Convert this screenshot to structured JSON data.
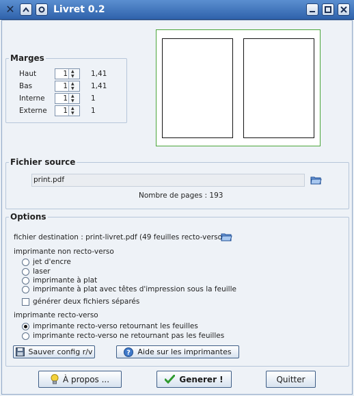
{
  "window": {
    "title": "Livret 0.2"
  },
  "marges": {
    "legend": "Marges",
    "rows": [
      {
        "label": "Haut",
        "value": "1",
        "computed": "1,41"
      },
      {
        "label": "Bas",
        "value": "1",
        "computed": "1,41"
      },
      {
        "label": "Interne",
        "value": "1",
        "computed": "1"
      },
      {
        "label": "Externe",
        "value": "1",
        "computed": "1"
      }
    ]
  },
  "source": {
    "legend": "Fichier source",
    "file": "print.pdf",
    "pages": "Nombre de pages : 193"
  },
  "options": {
    "legend": "Options",
    "destination": "fichier destination : print-livret.pdf (49 feuilles recto-verso)",
    "non_recto_verso_label": "imprimante non recto-verso",
    "non_recto_verso": [
      {
        "label": "jet d'encre",
        "checked": false
      },
      {
        "label": "laser",
        "checked": false
      },
      {
        "label": "imprimante à plat",
        "checked": false
      },
      {
        "label": "imprimante à plat avec têtes d'impression sous la feuille",
        "checked": false
      }
    ],
    "separate_files": "générer deux fichiers séparés",
    "recto_verso_label": "imprimante recto-verso",
    "recto_verso": [
      {
        "label": "imprimante recto-verso retournant les feuilles",
        "checked": true
      },
      {
        "label": "imprimante recto-verso ne retournant pas les feuilles",
        "checked": false
      }
    ],
    "save_config": "Sauver config r/v",
    "help_printers": "Aide sur les imprimantes"
  },
  "footer": {
    "about": "À propos ...",
    "generate": "Generer !",
    "quit": "Quitter"
  },
  "colors": {
    "titlebar": "#3a6db5",
    "preview_border": "#4aa53a"
  }
}
